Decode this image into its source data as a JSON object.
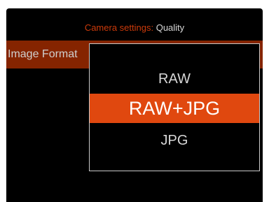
{
  "header": {
    "prefix": "Camera settings:",
    "value": "Quality"
  },
  "setting_row": {
    "label": "Image Format"
  },
  "popup": {
    "options": [
      {
        "label": "RAW",
        "selected": false
      },
      {
        "label": "RAW+JPG",
        "selected": true
      },
      {
        "label": "JPG",
        "selected": false
      }
    ]
  },
  "colors": {
    "accent": "#e0480f",
    "header_prefix": "#cc3a0a",
    "row_background": "#852400",
    "background": "#000000"
  }
}
